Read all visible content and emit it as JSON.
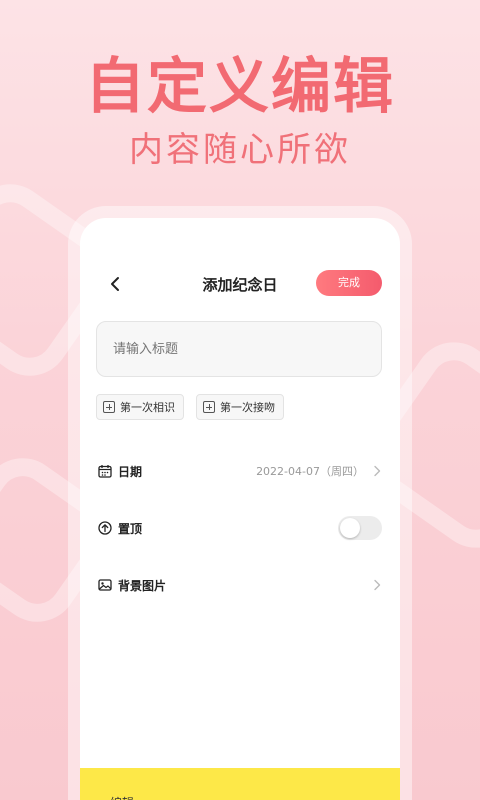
{
  "hero": {
    "title": "自定义编辑",
    "subtitle": "内容随心所欲"
  },
  "nav": {
    "title": "添加纪念日",
    "done_label": "完成",
    "back_icon": "chevron-left-icon"
  },
  "title_input": {
    "placeholder": "请输入标题",
    "value": ""
  },
  "chips": [
    {
      "label": "第一次相识",
      "icon": "plus-square-icon"
    },
    {
      "label": "第一次接吻",
      "icon": "plus-square-icon"
    }
  ],
  "rows": {
    "date": {
      "label": "日期",
      "value": "2022-04-07（周四）",
      "icon": "calendar-icon"
    },
    "pin": {
      "label": "置顶",
      "toggle_on": false,
      "icon": "arrow-up-circle-icon"
    },
    "background": {
      "label": "背景图片",
      "icon": "image-icon"
    }
  },
  "bottom": {
    "partial_text": "编辑"
  },
  "colors": {
    "accent": "#f26a72",
    "button_gradient_start": "#ff7a7f",
    "button_gradient_end": "#f45b6d",
    "bottom_bar": "#fde848"
  }
}
